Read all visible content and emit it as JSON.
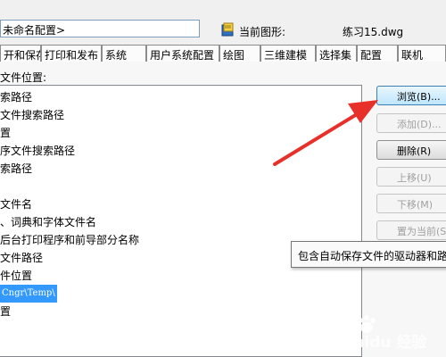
{
  "header": {
    "profile_label": "",
    "profile_value": "未命名配置>",
    "drawing_label": "当前图形:",
    "drawing_value": "练习15.dwg"
  },
  "tabs": [
    {
      "label": "开和保存"
    },
    {
      "label": "打印和发布"
    },
    {
      "label": "系统"
    },
    {
      "label": "用户系统配置"
    },
    {
      "label": "绘图"
    },
    {
      "label": "三维建模"
    },
    {
      "label": "选择集"
    },
    {
      "label": "配置"
    },
    {
      "label": "联机"
    }
  ],
  "panel": {
    "heading": "文件位置:"
  },
  "tree": {
    "items": [
      {
        "label": "索路径"
      },
      {
        "label": "文件搜索路径"
      },
      {
        "label": "置"
      },
      {
        "label": "序文件搜索路径"
      },
      {
        "label": "索路径"
      },
      {
        "label": ""
      },
      {
        "label": "文件名"
      },
      {
        "label": "、词典和字体文件名"
      },
      {
        "label": "后台打印程序和前导部分名称"
      },
      {
        "label": "文件路径"
      },
      {
        "label": "件位置"
      },
      {
        "label": "Cngr\\Temp\\",
        "selected": true
      },
      {
        "label": "置"
      },
      {
        "label": ""
      }
    ]
  },
  "buttons": [
    {
      "label": "浏览(B)...",
      "state": "active"
    },
    {
      "label": "添加(D)...",
      "state": "disabled"
    },
    {
      "label": "删除(R)",
      "state": "enabled"
    },
    {
      "label": "上移(U)",
      "state": "disabled"
    },
    {
      "label": "下移(M)",
      "state": "disabled"
    },
    {
      "label": "置为当前(S)",
      "state": "disabled"
    }
  ],
  "tooltip": {
    "text": "包含自动保存文件的驱动器和路"
  },
  "watermark": {
    "text": "Baidu 经验"
  },
  "colors": {
    "arrow": "#e8302a",
    "selection": "#3399ff"
  }
}
